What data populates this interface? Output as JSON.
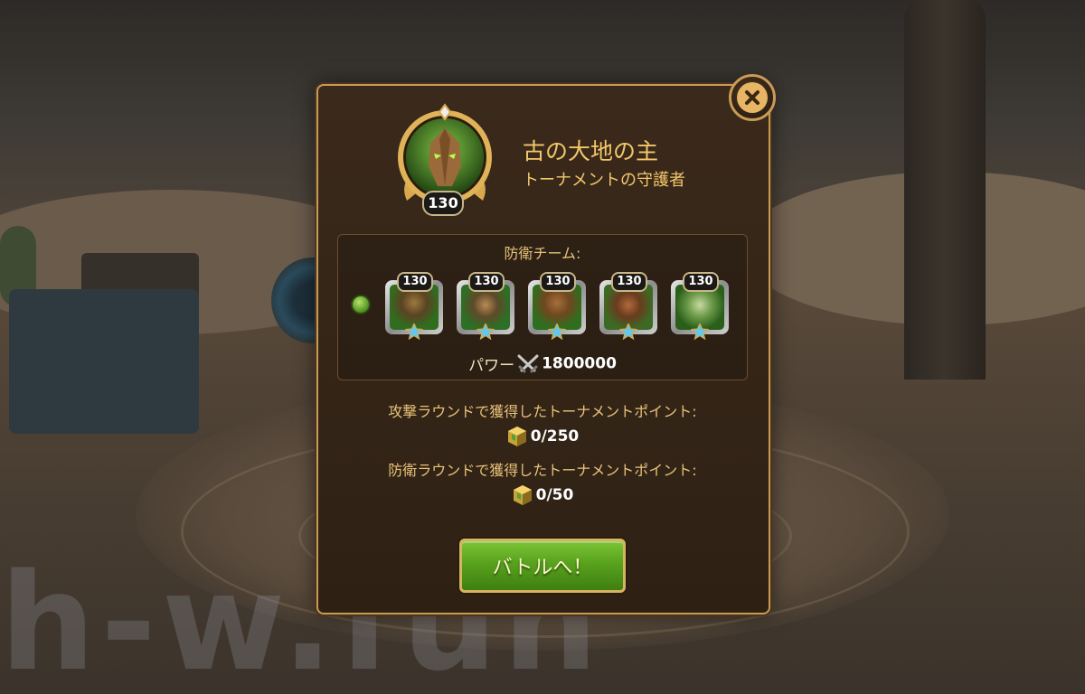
{
  "watermark": "h-w.fun",
  "boss": {
    "name": "古の大地の主",
    "subtitle": "トーナメントの守護者",
    "level": "130",
    "portrait_icon": "earth-lord-portrait-icon"
  },
  "defense_team": {
    "label": "防衛チーム:",
    "element_icon": "nature-element-icon",
    "heroes": [
      {
        "level": "130",
        "icon": "hero-1-portrait-icon",
        "stars": 1
      },
      {
        "level": "130",
        "icon": "hero-2-portrait-icon",
        "stars": 1
      },
      {
        "level": "130",
        "icon": "hero-3-portrait-icon",
        "stars": 1
      },
      {
        "level": "130",
        "icon": "hero-4-portrait-icon",
        "stars": 1
      },
      {
        "level": "130",
        "icon": "hero-5-portrait-icon",
        "stars": 1
      }
    ],
    "power_label": "パワー",
    "power_value": "1800000"
  },
  "points": {
    "attack_label": "攻撃ラウンドで獲得したトーナメントポイント:",
    "attack_value": "0/250",
    "defense_label": "防衛ラウンドで獲得したトーナメントポイント:",
    "defense_value": "0/50"
  },
  "battle_button": "バトルへ！",
  "colors": {
    "accent_gold": "#f2c76a",
    "button_green": "#58a21d",
    "frame_gold": "#c89a52",
    "panel_brown": "#342517"
  }
}
